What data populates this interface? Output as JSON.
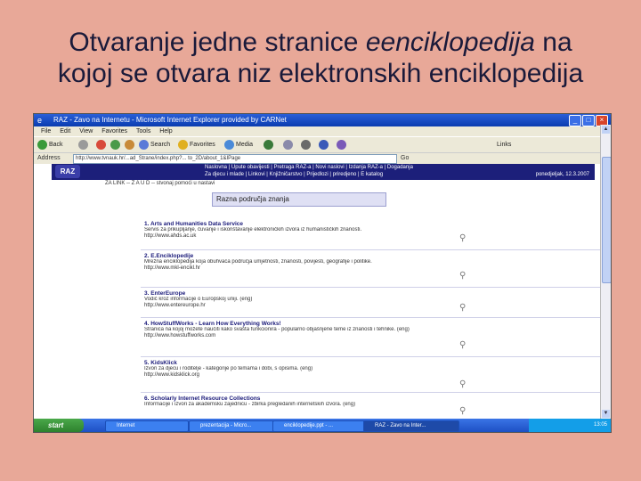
{
  "slide": {
    "title_part1": "Otvaranje jedne stranice ",
    "title_italic": "eenciklopedija",
    "title_part2": " na",
    "title_line2": "kojoj se otvara niz elektronskih enciklopedija"
  },
  "browser": {
    "window_title": "RAZ - Zavo na Internetu - Microsoft Internet Explorer provided by CARNet",
    "menu": [
      "File",
      "Edit",
      "View",
      "Favorites",
      "Tools",
      "Help"
    ],
    "toolbar": {
      "back": "Back",
      "search": "Search",
      "favorites": "Favorites",
      "media": "Media",
      "links": "Links"
    },
    "address_label": "Address",
    "address_url": "http://www.tvnauk.hr/...ad_Strane/index.php?... to_2D/about_1&IPage",
    "go": "Go"
  },
  "site": {
    "logo": "RAZ",
    "nav_line1": "Naslovna | Upute obavijesti | Pretraga RAZ-a | Novi naslovi | Izdanja RAZ-a | Dogadanja",
    "nav_line2": "Za djecu i mlade | Linkovi | Knjižničarstvo | Prijedlozi | priredjeno | E katalog",
    "date": "ponedjeljak, 12.3.2007",
    "crumb": "ZA LINK -- Z A U D -- stvonaj pomoći u nastavi",
    "section_title": "Razna područja znanja"
  },
  "entries": [
    {
      "title": "1. Arts and Humanities Data Service",
      "desc": "Servis za prikupljanje, čuvanje i iskorištavanje elektroničkih izvora iz humanističkih znanosti.",
      "url": "http://www.ahds.ac.uk"
    },
    {
      "title": "2. E.Enciklopedije",
      "desc": "Mrežna enciklopedija koja obuhvaća područja umjetnosti, znanosti, povijesti, geografije i politike.",
      "url": "http://www.mkl-encikl.hr"
    },
    {
      "title": "3. EnterEurope",
      "desc": "Vodič kroz informacije o Europskoj uniji. (eng)",
      "url": "http://www.entereurope.hr"
    },
    {
      "title": "4. HowStuffWorks - Learn How Everything Works!",
      "desc": "Stranica na kojoj možete naučiti kako svašta funkcionira - popularno objašnjene teme iz znanosti i tehnike. (eng)",
      "url": "http://www.howstuffworks.com"
    },
    {
      "title": "5. KidsKlick",
      "desc": "Izvori za djecu i roditelje - kategorije po temama i dobi, s opisima. (eng)",
      "url": "http://www.kidsklick.org"
    },
    {
      "title": "6. Scholarly Internet Resource Collections",
      "desc": "Informacije i izvori za akademsku zajednicu - zbirka pregledanih internetskih izvora. (eng)",
      "url": ""
    }
  ],
  "taskbar": {
    "start": "start",
    "items": [
      "Internet",
      "prezentacija - Micro...",
      "enciklopedije.ppt - ...",
      "RAZ - Zavo na Inter..."
    ],
    "time": "13:05"
  },
  "colors": {
    "slide_bg": "#e8a898",
    "site_header": "#1c1f7a",
    "taskbar": "#1d50c4"
  }
}
